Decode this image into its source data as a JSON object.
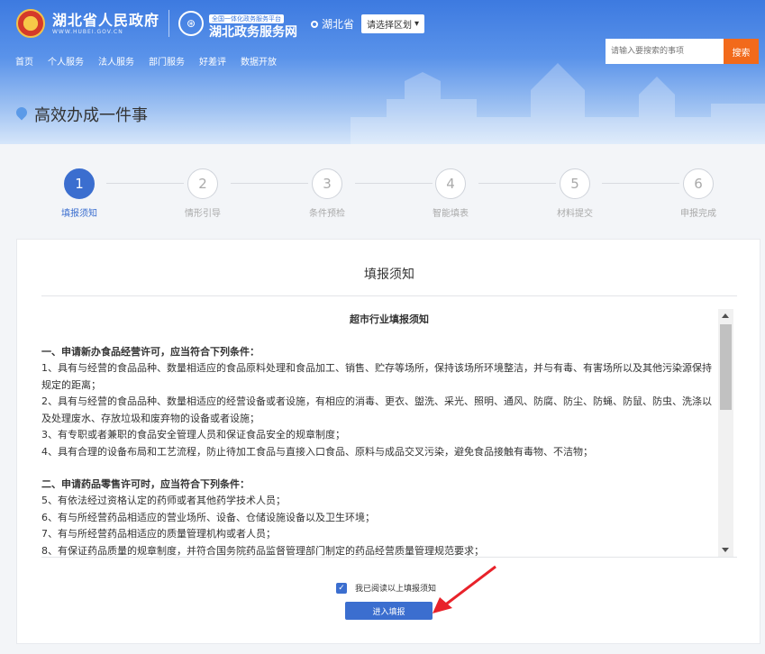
{
  "header": {
    "gov_title": "湖北省人民政府",
    "gov_subtitle": "WWW.HUBEI.GOV.CN",
    "portal_tag": "全国一体化政务服务平台",
    "portal_name": "湖北政务服务网",
    "region": "湖北省",
    "region_select": "请选择区划",
    "nav": [
      "首页",
      "个人服务",
      "法人服务",
      "部门服务",
      "好差评",
      "数据开放"
    ],
    "search_placeholder": "请输入要搜索的事项",
    "search_button": "搜索",
    "page_heading": "高效办成一件事"
  },
  "steps": [
    {
      "num": "1",
      "label": "填报须知",
      "active": true
    },
    {
      "num": "2",
      "label": "情形引导",
      "active": false
    },
    {
      "num": "3",
      "label": "条件预检",
      "active": false
    },
    {
      "num": "4",
      "label": "智能填表",
      "active": false
    },
    {
      "num": "5",
      "label": "材料提交",
      "active": false
    },
    {
      "num": "6",
      "label": "申报完成",
      "active": false
    }
  ],
  "card": {
    "title": "填报须知",
    "notice_title": "超市行业填报须知",
    "section1_heading": "一、申请新办食品经营许可，应当符合下列条件：",
    "section1_items": [
      "1、具有与经营的食品品种、数量相适应的食品原料处理和食品加工、销售、贮存等场所，保持该场所环境整洁，并与有毒、有害场所以及其他污染源保持规定的距离；",
      "2、具有与经营的食品品种、数量相适应的经营设备或者设施，有相应的消毒、更衣、盥洗、采光、照明、通风、防腐、防尘、防蝇、防鼠、防虫、洗涤以及处理废水、存放垃圾和废弃物的设备或者设施；",
      "3、有专职或者兼职的食品安全管理人员和保证食品安全的规章制度；",
      "4、具有合理的设备布局和工艺流程，防止待加工食品与直接入口食品、原料与成品交叉污染，避免食品接触有毒物、不洁物；"
    ],
    "section2_heading": "二、申请药品零售许可时，应当符合下列条件：",
    "section2_items": [
      "5、有依法经过资格认定的药师或者其他药学技术人员；",
      "6、有与所经营药品相适应的营业场所、设备、仓储设施设备以及卫生环境；",
      "7、有与所经营药品相适应的质量管理机构或者人员；",
      "8、有保证药品质量的规章制度，并符合国务院药品监督管理部门制定的药品经营质量管理规范要求；"
    ],
    "agree_label": "我已阅读以上填报须知",
    "agree_checked": true,
    "enter_button": "进入填报"
  },
  "colors": {
    "accent": "#3b6ecf",
    "search_button": "#f26a1b",
    "annotation_arrow": "#e8222a"
  }
}
